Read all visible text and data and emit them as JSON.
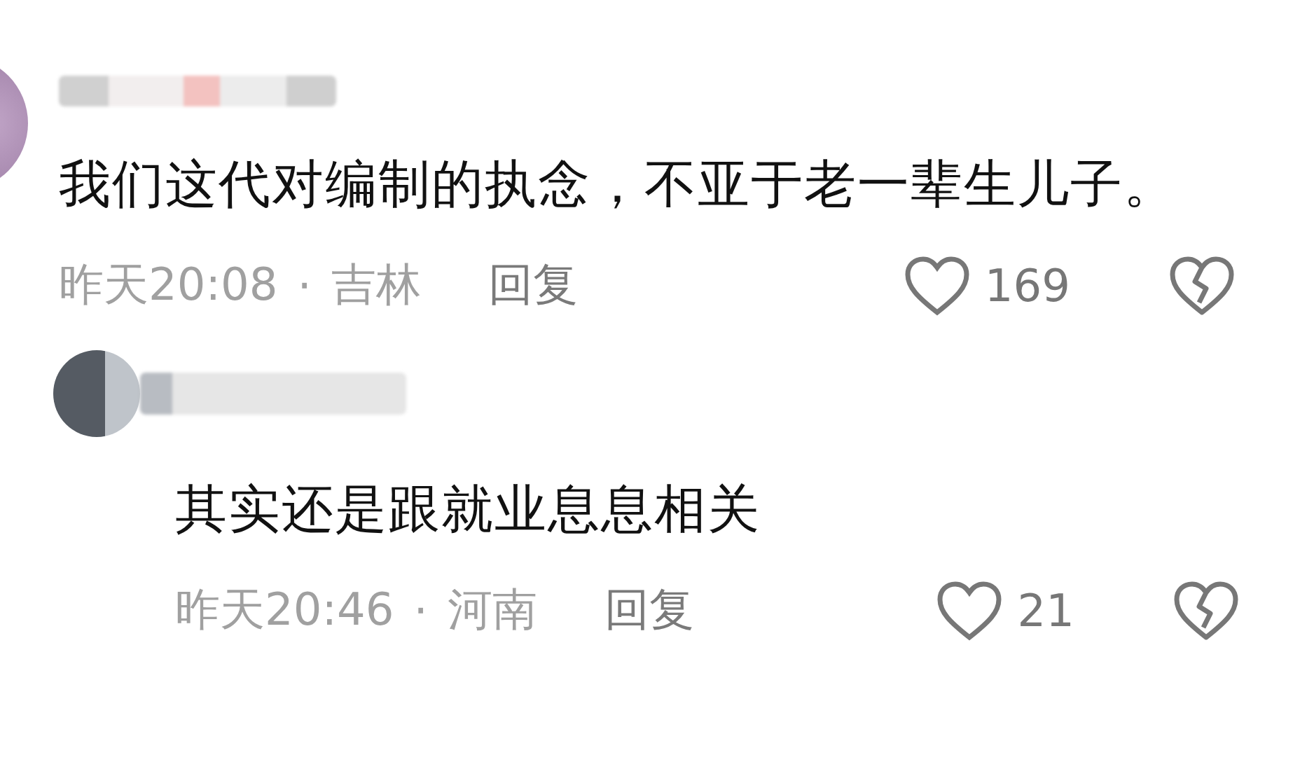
{
  "comments": [
    {
      "text": "我们这代对编制的执念，不亚于老一辈生儿子。",
      "time": "昨天20:08",
      "separator": "·",
      "location": "吉林",
      "reply_label": "回复",
      "likes": "169",
      "replies": [
        {
          "text": "其实还是跟就业息息相关",
          "time": "昨天20:46",
          "separator": "·",
          "location": "河南",
          "reply_label": "回复",
          "likes": "21"
        }
      ]
    }
  ]
}
